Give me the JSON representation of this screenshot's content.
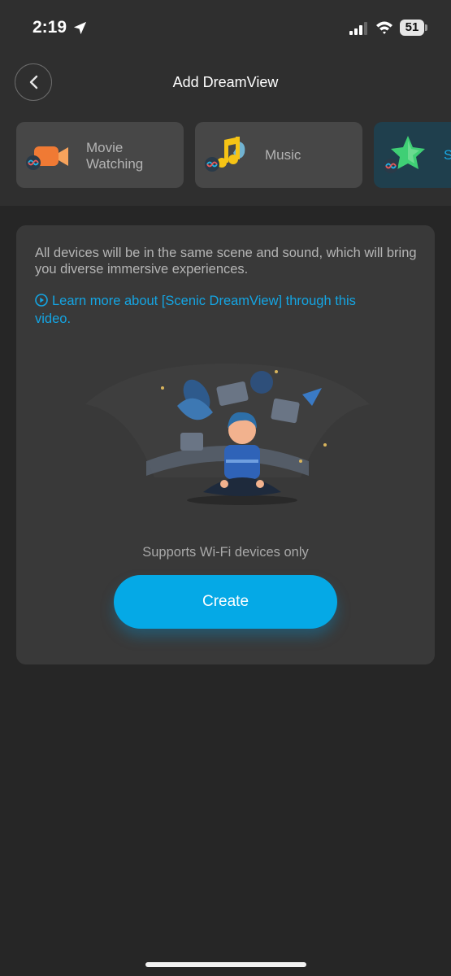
{
  "status_bar": {
    "time": "2:19",
    "battery_level": "51"
  },
  "header": {
    "title": "Add DreamView"
  },
  "scenes": [
    {
      "label": "Movie\nWatching",
      "icon": "camera-icon",
      "active": false
    },
    {
      "label": "Music",
      "icon": "music-note-icon",
      "active": false
    },
    {
      "label": "S",
      "icon": "star-icon",
      "active": true
    }
  ],
  "main": {
    "description": "All devices will be in the same scene and sound, which will bring you diverse immersive experiences.",
    "learn_more": "Learn more about [Scenic DreamView] through this video.",
    "support_note": "Supports Wi-Fi devices only",
    "create_label": "Create"
  },
  "colors": {
    "accent": "#05a9e6",
    "panel": "#393939",
    "background": "#262626"
  }
}
